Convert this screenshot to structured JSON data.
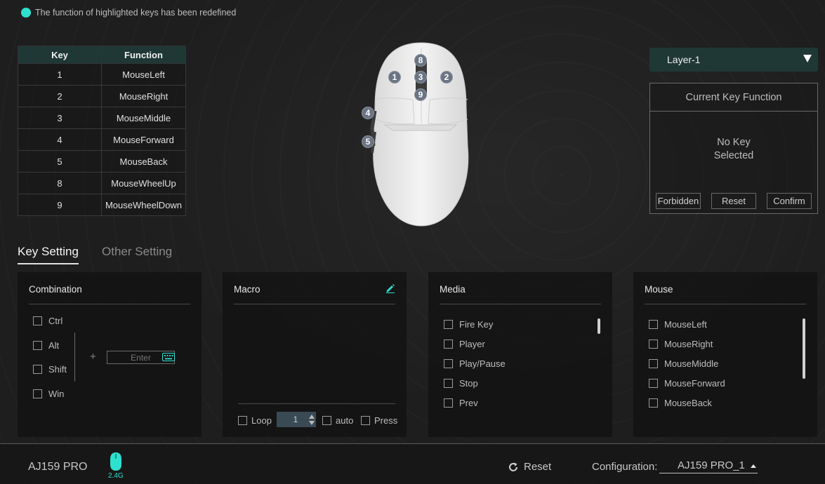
{
  "notice": {
    "text": "The function of highlighted keys has been redefined",
    "color": "#2ee0d0"
  },
  "key_table": {
    "headers": [
      "Key",
      "Function"
    ],
    "rows": [
      [
        "1",
        "MouseLeft"
      ],
      [
        "2",
        "MouseRight"
      ],
      [
        "3",
        "MouseMiddle"
      ],
      [
        "4",
        "MouseForward"
      ],
      [
        "5",
        "MouseBack"
      ],
      [
        "8",
        "MouseWheelUp"
      ],
      [
        "9",
        "MouseWheelDown"
      ]
    ]
  },
  "mouse_badges": [
    "1",
    "2",
    "3",
    "4",
    "5",
    "8",
    "9"
  ],
  "layer": {
    "selected": "Layer-1"
  },
  "current_key_function": {
    "title": "Current Key Function",
    "status_line1": "No Key",
    "status_line2": "Selected",
    "buttons": {
      "forbidden": "Forbidden",
      "reset": "Reset",
      "confirm": "Confirm"
    }
  },
  "tabs": {
    "key_setting": "Key Setting",
    "other_setting": "Other Setting"
  },
  "combination": {
    "title": "Combination",
    "modifiers": [
      "Ctrl",
      "Alt",
      "Shift",
      "Win"
    ],
    "plus": "+",
    "input_placeholder": "Enter"
  },
  "macro": {
    "title": "Macro",
    "loop_label": "Loop",
    "loop_value": "1",
    "auto_label": "auto",
    "press_label": "Press"
  },
  "media": {
    "title": "Media",
    "items": [
      "Fire Key",
      "Player",
      "Play/Pause",
      "Stop",
      "Prev"
    ]
  },
  "mouse_panel": {
    "title": "Mouse",
    "items": [
      "MouseLeft",
      "MouseRight",
      "MouseMiddle",
      "MouseForward",
      "MouseBack"
    ]
  },
  "bottom": {
    "device_name": "AJ159 PRO",
    "connection": "2.4G",
    "reset_label": "Reset",
    "config_label": "Configuration:",
    "config_value": "AJ159 PRO_1"
  },
  "colors": {
    "accent": "#2ee0d0",
    "header_bg": "#1f3836"
  }
}
